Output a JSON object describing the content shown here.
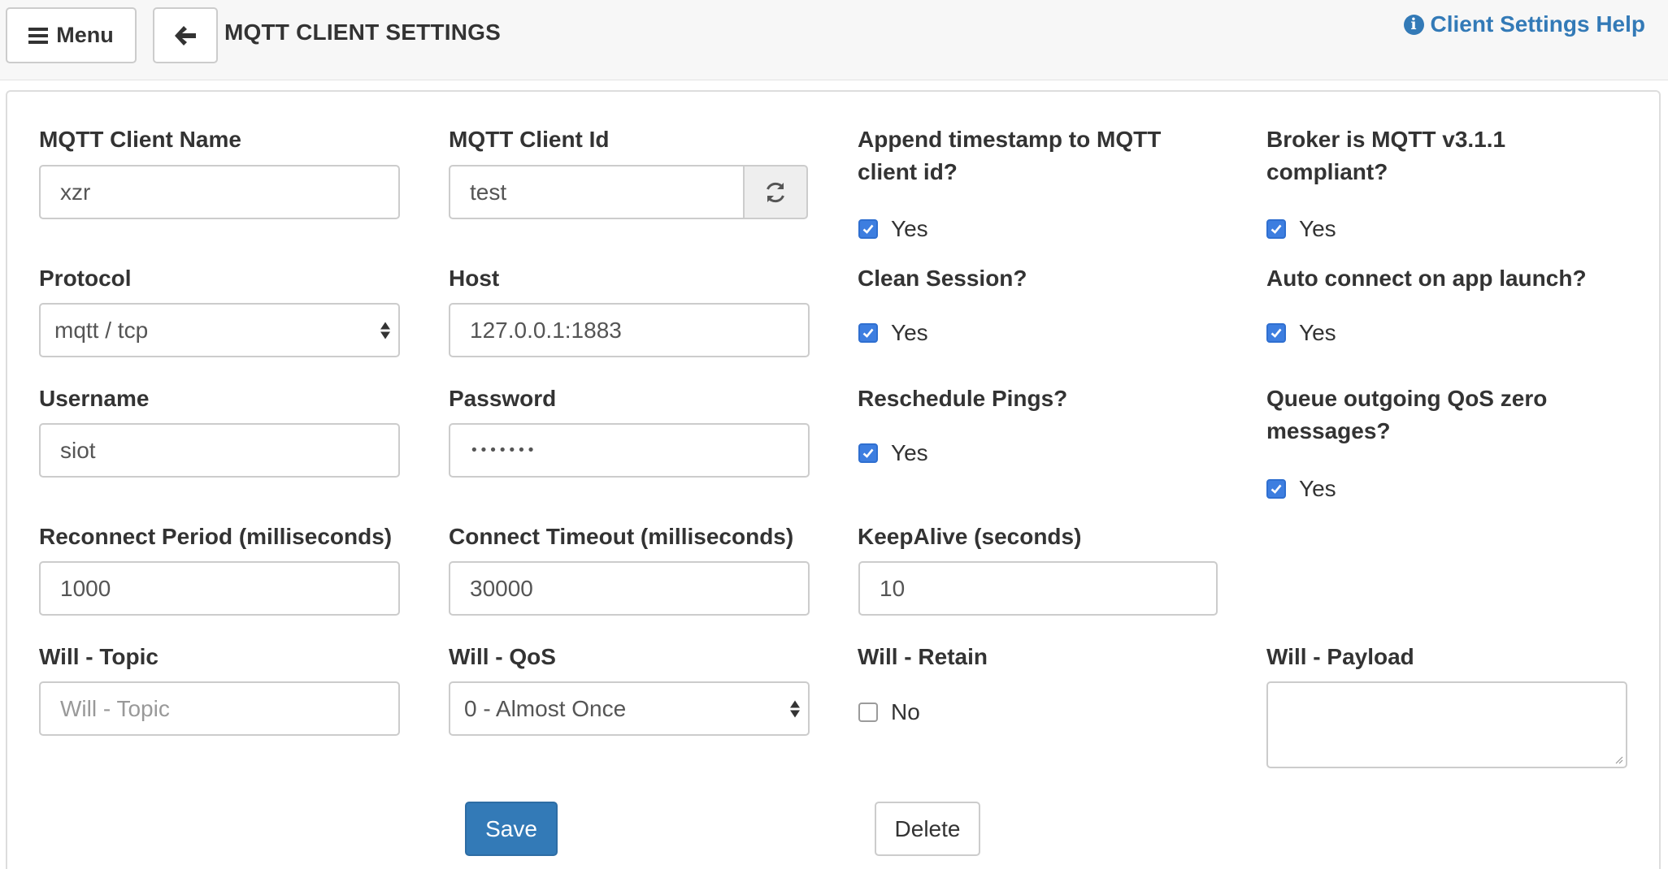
{
  "header": {
    "menu_label": "Menu",
    "title": "MQTT CLIENT SETTINGS",
    "help_label": "Client Settings Help"
  },
  "form": {
    "client_name": {
      "label": "MQTT Client Name",
      "value": "xzr"
    },
    "client_id": {
      "label": "MQTT Client Id",
      "value": "test"
    },
    "append_timestamp": {
      "label": "Append timestamp to MQTT client id?",
      "option": "Yes",
      "checked": true
    },
    "broker_compliant": {
      "label": "Broker is MQTT v3.1.1 compliant?",
      "option": "Yes",
      "checked": true
    },
    "protocol": {
      "label": "Protocol",
      "value": "mqtt / tcp"
    },
    "host": {
      "label": "Host",
      "value": "127.0.0.1:1883"
    },
    "clean_session": {
      "label": "Clean Session?",
      "option": "Yes",
      "checked": true
    },
    "auto_connect": {
      "label": "Auto connect on app launch?",
      "option": "Yes",
      "checked": true
    },
    "username": {
      "label": "Username",
      "value": "siot"
    },
    "password": {
      "label": "Password",
      "value": "•••••••"
    },
    "reschedule_pings": {
      "label": "Reschedule Pings?",
      "option": "Yes",
      "checked": true
    },
    "queue_qos_zero": {
      "label": "Queue outgoing QoS zero messages?",
      "option": "Yes",
      "checked": true
    },
    "reconnect_period": {
      "label": "Reconnect Period (milliseconds)",
      "value": "1000"
    },
    "connect_timeout": {
      "label": "Connect Timeout (milliseconds)",
      "value": "30000"
    },
    "keepalive": {
      "label": "KeepAlive (seconds)",
      "value": "10"
    },
    "will_topic": {
      "label": "Will - Topic",
      "placeholder": "Will - Topic"
    },
    "will_qos": {
      "label": "Will - QoS",
      "value": "0 - Almost Once"
    },
    "will_retain": {
      "label": "Will - Retain",
      "option": "No",
      "checked": false
    },
    "will_payload": {
      "label": "Will - Payload",
      "value": ""
    }
  },
  "actions": {
    "save_label": "Save",
    "delete_label": "Delete"
  },
  "colors": {
    "primary": "#337ab7",
    "checkbox": "#3d7ee0",
    "border": "#cccccc"
  }
}
